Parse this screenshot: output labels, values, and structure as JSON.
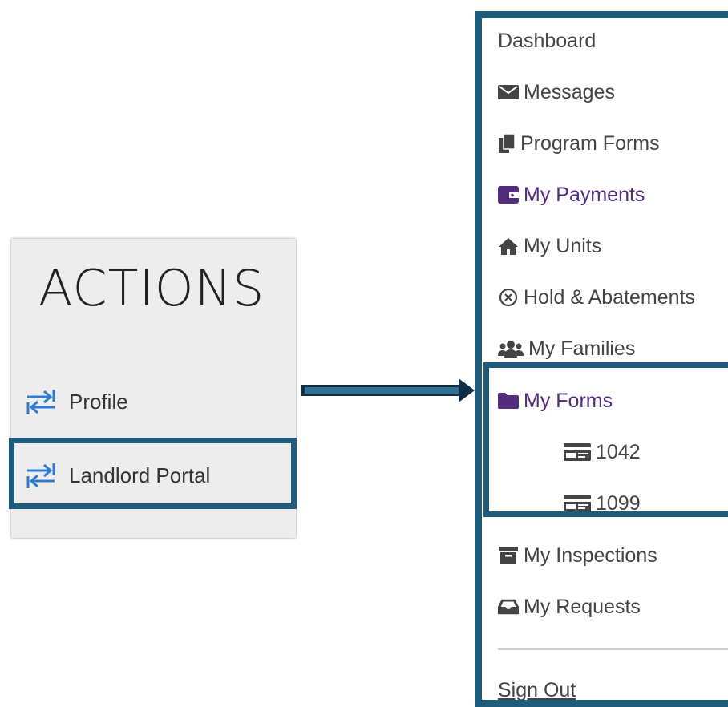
{
  "actions": {
    "title": "ACTIONS",
    "items": [
      {
        "label": "Profile",
        "icon": "swap-arrows-icon"
      },
      {
        "label": "Landlord Portal",
        "icon": "swap-arrows-icon"
      }
    ]
  },
  "menu": {
    "items": [
      {
        "label": "Dashboard"
      },
      {
        "label": "Messages",
        "icon": "envelope-icon"
      },
      {
        "label": "Program Forms",
        "icon": "documents-icon"
      },
      {
        "label": "My Payments",
        "icon": "wallet-icon"
      },
      {
        "label": "My Units",
        "icon": "home-icon"
      },
      {
        "label": "Hold & Abatements",
        "icon": "circle-x-icon"
      },
      {
        "label": "My Families",
        "icon": "users-icon"
      },
      {
        "label": "My Forms",
        "icon": "folder-icon"
      },
      {
        "label": "1042",
        "icon": "id-card-icon"
      },
      {
        "label": "1099",
        "icon": "id-card-icon"
      },
      {
        "label": "My Inspections",
        "icon": "archive-icon"
      },
      {
        "label": "My Requests",
        "icon": "inbox-icon"
      }
    ],
    "sign_out": "Sign Out"
  },
  "colors": {
    "highlight_border": "#1f5b7a",
    "icon_blue": "#2e7bd6",
    "active_purple": "#522d7d",
    "panel_bg": "#ededed",
    "arrow_fill": "#0f2e45"
  }
}
